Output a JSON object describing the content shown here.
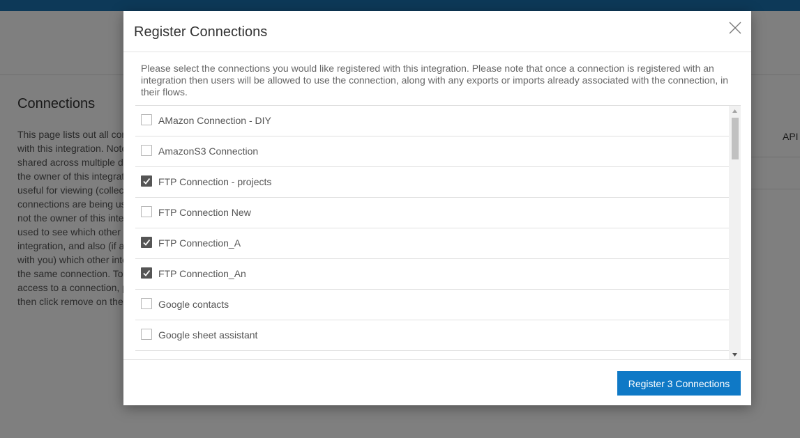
{
  "colors": {
    "topbar": "#1a73b0",
    "primary_button": "#0f79c6",
    "checkbox_checked": "#555555"
  },
  "background": {
    "title": "Connections",
    "description_lines": [
      "This page lists out all con",
      "with this integration. Note",
      "shared across multiple di",
      "the owner of this integrat",
      "useful for viewing (collec",
      "connections are being us",
      "not the owner of this inte",
      "used to see which other c",
      "integration, and also (if a",
      "with you) which other inte",
      "the same connection. To",
      "access to a connection, p",
      "then click remove on the"
    ],
    "table_header_api": "API"
  },
  "modal": {
    "title": "Register Connections",
    "close_icon": "close-icon",
    "description": "Please select the connections you would like registered with this integration. Please note that once a connection is registered with an integration then users will be allowed to use the connection, along with any exports or imports already associated with the connection, in their flows.",
    "connections": [
      {
        "label": "AMazon Connection - DIY",
        "checked": false
      },
      {
        "label": "AmazonS3 Connection",
        "checked": false
      },
      {
        "label": "FTP Connection - projects",
        "checked": true
      },
      {
        "label": "FTP Connection New",
        "checked": false
      },
      {
        "label": "FTP Connection_A",
        "checked": true
      },
      {
        "label": "FTP Connection_An",
        "checked": true
      },
      {
        "label": "Google contacts",
        "checked": false
      },
      {
        "label": "Google sheet assistant",
        "checked": false
      }
    ],
    "register_button": "Register 3 Connections"
  }
}
